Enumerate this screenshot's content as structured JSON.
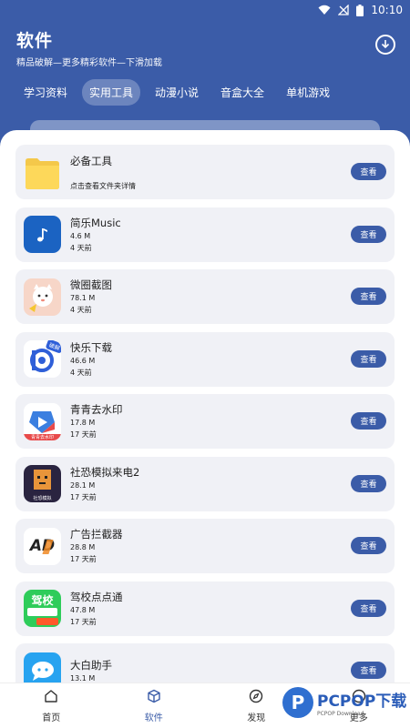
{
  "status_bar": {
    "time": "10:10"
  },
  "header": {
    "title": "软件",
    "subtitle": "精品破解—更多精彩软件—下滑加载"
  },
  "tabs": [
    {
      "label": "学习资料"
    },
    {
      "label": "实用工具"
    },
    {
      "label": "动漫小说"
    },
    {
      "label": "音盒大全"
    },
    {
      "label": "单机游戏"
    }
  ],
  "active_tab": "实用工具",
  "folder_card": {
    "name": "必备工具",
    "desc": "点击查看文件夹详情",
    "button": "查看"
  },
  "apps": [
    {
      "name": "简乐Music",
      "size": "4.6 M",
      "time": "4 天前",
      "button": "查看",
      "icon": "music-note-icon"
    },
    {
      "name": "微圈截图",
      "size": "78.1 M",
      "time": "4 天前",
      "button": "查看",
      "icon": "cartoon-cat-icon"
    },
    {
      "name": "快乐下载",
      "size": "46.6 M",
      "time": "4 天前",
      "button": "查看",
      "icon": "download-d-icon",
      "badge": "破解"
    },
    {
      "name": "青青去水印",
      "size": "17.8 M",
      "time": "17 天前",
      "button": "查看",
      "icon": "play-square-icon",
      "icon_caption": "青青去水印"
    },
    {
      "name": "社恐模拟来电2",
      "size": "28.1 M",
      "time": "17 天前",
      "button": "查看",
      "icon": "box-character-icon",
      "icon_caption": "社恐模拟"
    },
    {
      "name": "广告拦截器",
      "size": "28.8 M",
      "time": "17 天前",
      "button": "查看",
      "icon": "ad-block-icon",
      "icon_caption": "AD"
    },
    {
      "name": "驾校点点通",
      "size": "47.8 M",
      "time": "17 天前",
      "button": "查看",
      "icon": "driving-school-icon",
      "icon_caption": "驾校"
    },
    {
      "name": "大白助手",
      "size": "13.1 M",
      "time": "",
      "button": "查看",
      "icon": "chat-bubble-icon"
    }
  ],
  "bottom_nav": [
    {
      "label": "首页",
      "icon": "home-icon"
    },
    {
      "label": "软件",
      "icon": "cube-icon"
    },
    {
      "label": "发现",
      "icon": "compass-icon"
    },
    {
      "label": "更多",
      "icon": "user-icon"
    }
  ],
  "active_nav": "软件",
  "watermark": {
    "text": "PCPOP下载",
    "sub": "PCPOP Download"
  },
  "colors": {
    "primary": "#3b5ca8",
    "card_bg": "#f0f1f6"
  }
}
